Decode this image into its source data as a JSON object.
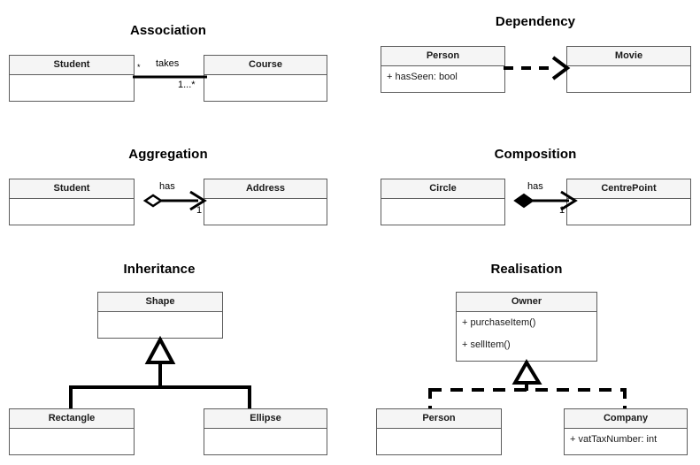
{
  "diagram": {
    "title_hidden": "",
    "background_color": "#ffffff",
    "line_color": "#000000",
    "box_border_color": "#5c5c5c",
    "header_fill_color": "#f5f5f5",
    "body_fill_color": "#ffffff"
  },
  "panels": [
    {
      "id": "association",
      "title": "Association",
      "classes": [
        {
          "name": "Student",
          "members": [
            ""
          ]
        },
        {
          "name": "Course",
          "members": [
            ""
          ]
        }
      ],
      "edge": {
        "kind": "association",
        "label": "takes",
        "source_multiplicity": "*",
        "target_multiplicity": "1...*"
      }
    },
    {
      "id": "dependency",
      "title": "Dependency",
      "classes": [
        {
          "name": "Person",
          "members": [
            "+ hasSeen: bool"
          ]
        },
        {
          "name": "Movie",
          "members": [
            ""
          ]
        }
      ],
      "edge": {
        "kind": "dependency",
        "label": "",
        "source_multiplicity": "",
        "target_multiplicity": ""
      }
    },
    {
      "id": "aggregation",
      "title": "Aggregation",
      "classes": [
        {
          "name": "Student",
          "members": [
            ""
          ]
        },
        {
          "name": "Address",
          "members": [
            ""
          ]
        }
      ],
      "edge": {
        "kind": "aggregation",
        "label": "has",
        "source_multiplicity": "",
        "target_multiplicity": "1"
      }
    },
    {
      "id": "composition",
      "title": "Composition",
      "classes": [
        {
          "name": "Circle",
          "members": [
            ""
          ]
        },
        {
          "name": "CentrePoint",
          "members": [
            ""
          ]
        }
      ],
      "edge": {
        "kind": "composition",
        "label": "has",
        "source_multiplicity": "",
        "target_multiplicity": "1"
      }
    },
    {
      "id": "inheritance",
      "title": "Inheritance",
      "classes": [
        {
          "name": "Shape",
          "members": [
            ""
          ]
        },
        {
          "name": "Rectangle",
          "members": [
            ""
          ]
        },
        {
          "name": "Ellipse",
          "members": [
            ""
          ]
        }
      ],
      "edge": {
        "kind": "inheritance",
        "label": "",
        "source_multiplicity": "",
        "target_multiplicity": ""
      }
    },
    {
      "id": "realisation",
      "title": "Realisation",
      "classes": [
        {
          "name": "Owner",
          "members": [
            "+ purchaseItem()",
            "+ sellItem()"
          ]
        },
        {
          "name": "Person",
          "members": [
            ""
          ]
        },
        {
          "name": "Company",
          "members": [
            "+ vatTaxNumber: int"
          ]
        }
      ],
      "edge": {
        "kind": "realisation",
        "label": "",
        "source_multiplicity": "",
        "target_multiplicity": ""
      }
    }
  ]
}
